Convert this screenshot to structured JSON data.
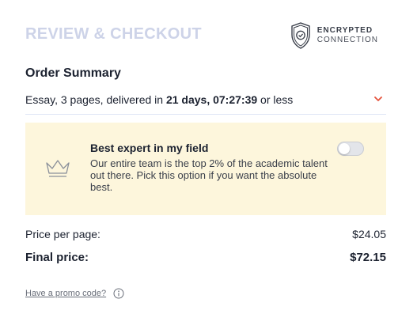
{
  "header": {
    "title": "REVIEW & CHECKOUT",
    "secure_line1": "ENCRYPTED",
    "secure_line2": "CONNECTION",
    "secure_icon": "shield-check-icon"
  },
  "order": {
    "section_title": "Order Summary",
    "summary_prefix": "Essay, 3 pages, delivered in ",
    "summary_deadline": "21 days, 07:27:39",
    "summary_suffix": " or less",
    "expand_icon": "chevron-down-icon",
    "accent_color": "#e5533d"
  },
  "expert_option": {
    "icon": "crown-icon",
    "title": "Best expert in my field",
    "description": "Our entire team is the top 2% of the academic talent out there. Pick this option if you want the absolute best.",
    "enabled": false,
    "background": "#fdf6dc"
  },
  "pricing": {
    "price_per_page_label": "Price per page:",
    "price_per_page_value": "$24.05",
    "final_price_label": "Final price:",
    "final_price_value": "$72.15"
  },
  "promo": {
    "link_text": "Have a promo code?",
    "info_icon": "info-icon"
  }
}
